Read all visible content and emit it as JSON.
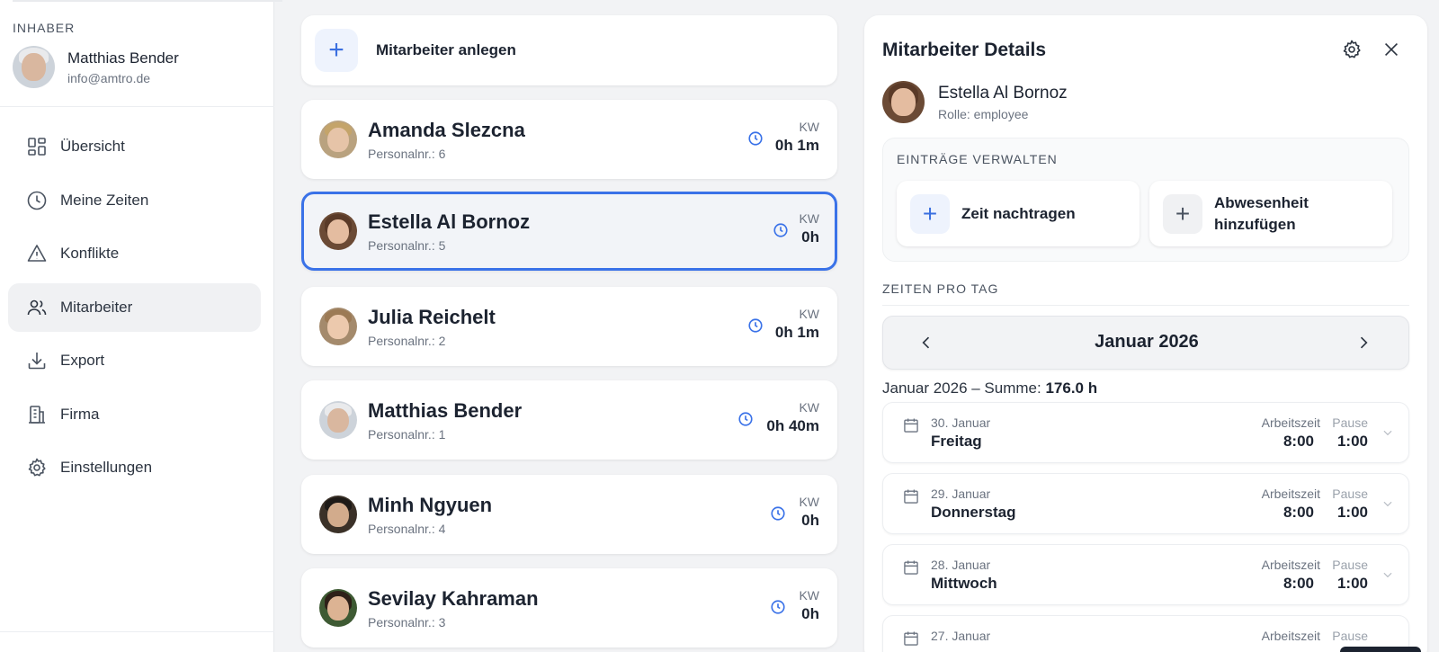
{
  "sidebar": {
    "owner_label": "INHABER",
    "owner_name": "Matthias Bender",
    "owner_email": "info@amtro.de",
    "nav": [
      {
        "label": "Übersicht",
        "icon": "grid-icon"
      },
      {
        "label": "Meine Zeiten",
        "icon": "clock-icon"
      },
      {
        "label": "Konflikte",
        "icon": "warning-icon"
      },
      {
        "label": "Mitarbeiter",
        "icon": "users-icon",
        "active": true
      },
      {
        "label": "Export",
        "icon": "download-icon"
      },
      {
        "label": "Firma",
        "icon": "building-icon"
      },
      {
        "label": "Einstellungen",
        "icon": "gear-icon"
      }
    ]
  },
  "list": {
    "add_label": "Mitarbeiter anlegen",
    "employees": [
      {
        "name": "Amanda Slezcna",
        "nr": "Personalnr.: 6",
        "kw": "KW",
        "hours": "0h 1m"
      },
      {
        "name": "Estella Al Bornoz",
        "nr": "Personalnr.: 5",
        "kw": "KW",
        "hours": "0h",
        "selected": true
      },
      {
        "name": "Julia Reichelt",
        "nr": "Personalnr.: 2",
        "kw": "KW",
        "hours": "0h 1m"
      },
      {
        "name": "Matthias Bender",
        "nr": "Personalnr.: 1",
        "kw": "KW",
        "hours": "0h 40m"
      },
      {
        "name": "Minh Ngyuen",
        "nr": "Personalnr.: 4",
        "kw": "KW",
        "hours": "0h"
      },
      {
        "name": "Sevilay Kahraman",
        "nr": "Personalnr.: 3",
        "kw": "KW",
        "hours": "0h"
      }
    ]
  },
  "detail": {
    "title": "Mitarbeiter Details",
    "user_name": "Estella Al Bornoz",
    "user_role": "Rolle: employee",
    "manage_title": "EINTRÄGE VERWALTEN",
    "action_time": "Zeit nachtragen",
    "action_absence_line1": "Abwesenheit",
    "action_absence_line2": "hinzufügen",
    "per_day_title": "ZEITEN PRO TAG",
    "month": "Januar 2026",
    "sum_prefix": "Januar 2026 – Summe: ",
    "sum_value": "176.0 h",
    "days": [
      {
        "date": "30. Januar",
        "weekday": "Freitag",
        "work_label": "Arbeitszeit",
        "work": "8:00",
        "pause_label": "Pause",
        "pause": "1:00"
      },
      {
        "date": "29. Januar",
        "weekday": "Donnerstag",
        "work_label": "Arbeitszeit",
        "work": "8:00",
        "pause_label": "Pause",
        "pause": "1:00"
      },
      {
        "date": "28. Januar",
        "weekday": "Mittwoch",
        "work_label": "Arbeitszeit",
        "work": "8:00",
        "pause_label": "Pause",
        "pause": "1:00"
      },
      {
        "date": "27. Januar",
        "weekday": "",
        "work_label": "Arbeitszeit",
        "work": "",
        "pause_label": "Pause",
        "pause": ""
      }
    ]
  },
  "colors": {
    "accent": "#3a72e8",
    "sidebar_active": "#f0f1f3",
    "background": "#f2f3f5"
  }
}
